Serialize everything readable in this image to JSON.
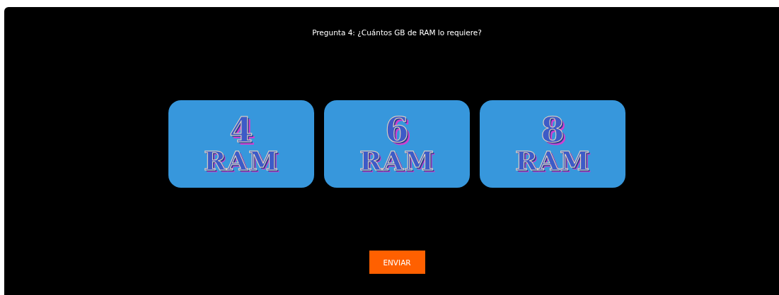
{
  "question": "Pregunta 4: ¿Cuántos GB de RAM lo requiere?",
  "options": [
    {
      "number": "4",
      "unit": "RAM"
    },
    {
      "number": "6",
      "unit": "RAM"
    },
    {
      "number": "8",
      "unit": "RAM"
    }
  ],
  "submit_button": "ENVIAR"
}
